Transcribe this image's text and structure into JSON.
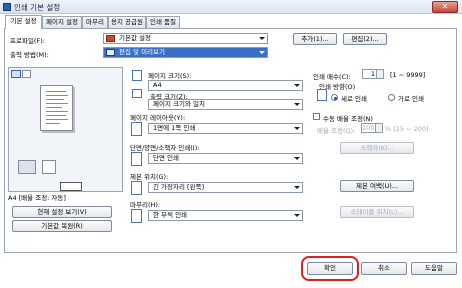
{
  "window": {
    "title": "인쇄 기본 설정",
    "close": "✕"
  },
  "tabs": [
    "기본 설정",
    "페이지 설정",
    "마무리",
    "용지 공급원",
    "인쇄 품질"
  ],
  "profile": {
    "label": "프로파일(F):",
    "value": "기본값 설정",
    "add": "추가(1)...",
    "edit": "편집(2)..."
  },
  "output": {
    "label": "출력 방법(M):",
    "value": "편집 및 미리보기"
  },
  "preview": {
    "status": "A4 [배율 조정: 자동]",
    "view_settings": "현재 설정 보기(V)",
    "restore": "기본값 복원(R)"
  },
  "page_size": {
    "label": "페이지 크기(S):",
    "value": "A4"
  },
  "output_size": {
    "label": "출력 크기(Z):",
    "value": "페이지 크기와 일치"
  },
  "layout": {
    "label": "페이지 레이아웃(Y):",
    "value": "1면에 1쪽 인쇄"
  },
  "duplex": {
    "label": "단면/양면/소책자 인쇄(I):",
    "value": "단면 인쇄"
  },
  "binding": {
    "label": "제본 위치(G):",
    "value": "긴 가장자리 [왼쪽]",
    "margin_button": "제본 여백(U)..."
  },
  "finishing": {
    "label": "마무리(H):",
    "value": "한 부씩 인쇄",
    "staple_button": "스테이플 위치(L)..."
  },
  "copies": {
    "label": "인쇄 매수(C):",
    "value": "1",
    "range": "[1 ~ 9999]"
  },
  "orientation": {
    "label": "인쇄 방향(O)",
    "portrait": "세로 인쇄",
    "landscape": "가로 인쇄",
    "selected": "portrait"
  },
  "manual_scale": {
    "label": "수동 배율 조정(N)",
    "scale_label": "배율 조정(Q):",
    "value": "100",
    "range": "% [25 ~ 200]"
  },
  "booklet_button": "소책자(K)...",
  "footer": {
    "ok": "확인",
    "cancel": "취소",
    "help": "도움말"
  }
}
